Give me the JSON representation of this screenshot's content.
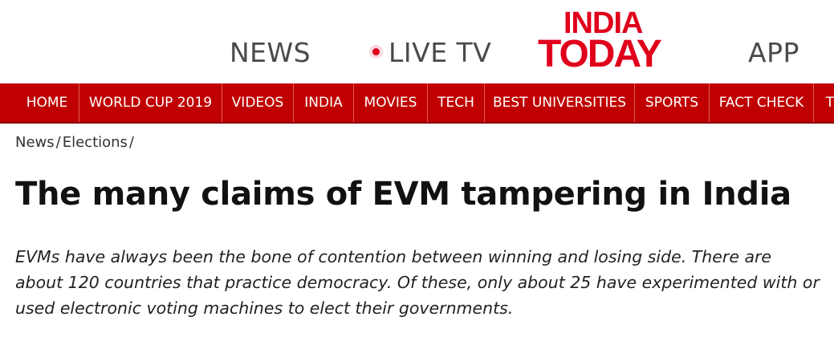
{
  "header": {
    "news_label": "NEWS",
    "live_tv_label": "LIVE TV",
    "app_label": "APP",
    "logo": {
      "line1": "INDIA",
      "line2": "TODAY"
    }
  },
  "nav": {
    "items": [
      {
        "label": "HOME"
      },
      {
        "label": "WORLD CUP 2019"
      },
      {
        "label": "VIDEOS"
      },
      {
        "label": "INDIA"
      },
      {
        "label": "MOVIES"
      },
      {
        "label": "TECH"
      },
      {
        "label": "BEST UNIVERSITIES"
      },
      {
        "label": "SPORTS"
      },
      {
        "label": "FACT CHECK"
      },
      {
        "label": "T"
      }
    ]
  },
  "breadcrumb": {
    "items": [
      {
        "label": "News"
      },
      {
        "label": "Elections"
      }
    ],
    "separator": "/"
  },
  "article": {
    "title": "The many claims of EVM tampering in India",
    "summary": "EVMs have always been the bone of contention between winning and losing side. There are about 120 countries that practice democracy. Of these, only about 25 have experimented with or used electronic voting machines to elect their governments."
  },
  "colors": {
    "brand_red": "#e0001b",
    "nav_background": "#c00000",
    "nav_text": "#ffffff",
    "header_text": "#4a4a4a"
  }
}
